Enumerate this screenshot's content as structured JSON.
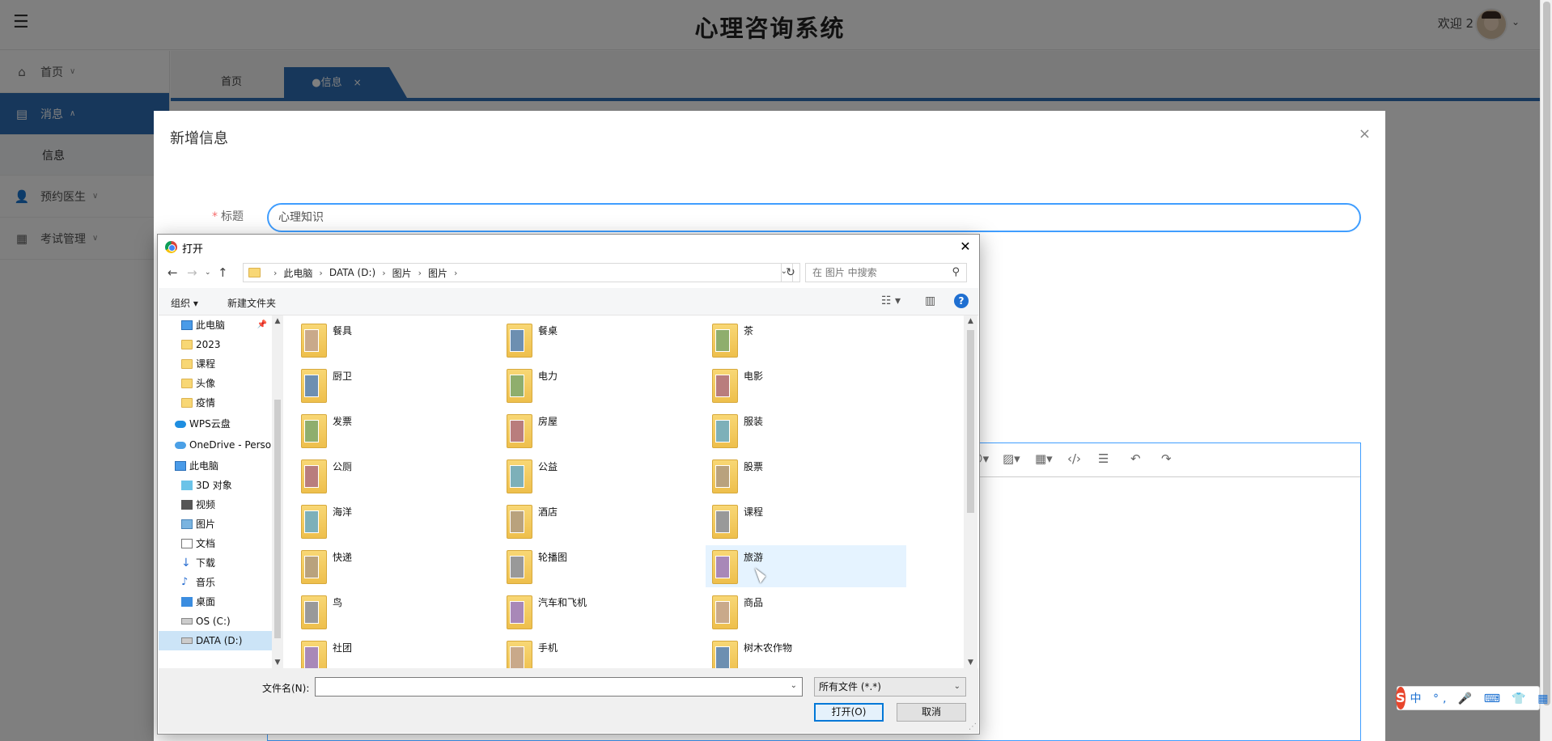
{
  "app": {
    "title": "心理咨询系统",
    "welcome": "欢迎 2"
  },
  "sidebar": {
    "items": [
      {
        "label": "首页",
        "icon": "home-icon"
      },
      {
        "label": "消息",
        "icon": "message-icon",
        "expanded": true,
        "children": [
          "信息"
        ]
      },
      {
        "label": "预约医生",
        "icon": "user-icon"
      },
      {
        "label": "考试管理",
        "icon": "grid-icon"
      }
    ],
    "sub_label": "信息"
  },
  "tabs": [
    {
      "label": "首页"
    },
    {
      "label": "●信息",
      "close": "×",
      "active": true
    }
  ],
  "modal": {
    "title": "新增信息",
    "close": "×",
    "field_label": "标题",
    "required_mark": "*",
    "title_value": "心理知识"
  },
  "file_dialog": {
    "title": "打开",
    "close": "✕",
    "breadcrumb": [
      "此电脑",
      "DATA (D:)",
      "图片",
      "图片"
    ],
    "search_placeholder": "在 图片 中搜索",
    "organize": "组织 ▾",
    "new_folder": "新建文件夹",
    "help": "?",
    "tree": [
      {
        "label": "此电脑",
        "icon": "pc",
        "indent": 1,
        "pin": true
      },
      {
        "label": "2023",
        "icon": "folder",
        "indent": 1
      },
      {
        "label": "课程",
        "icon": "folder",
        "indent": 1
      },
      {
        "label": "头像",
        "icon": "folder",
        "indent": 1
      },
      {
        "label": "疫情",
        "icon": "folder",
        "indent": 1
      },
      {
        "label": "",
        "icon": "",
        "indent": 0,
        "spacer": true
      },
      {
        "label": "WPS云盘",
        "icon": "cloud",
        "indent": 0
      },
      {
        "label": "",
        "icon": "",
        "indent": 0,
        "spacer": true
      },
      {
        "label": "OneDrive - Perso",
        "icon": "cloud-w",
        "indent": 0
      },
      {
        "label": "",
        "icon": "",
        "indent": 0,
        "spacer": true
      },
      {
        "label": "此电脑",
        "icon": "pc",
        "indent": 0
      },
      {
        "label": "3D 对象",
        "icon": "3d",
        "indent": 1
      },
      {
        "label": "视频",
        "icon": "video",
        "indent": 1
      },
      {
        "label": "图片",
        "icon": "pic",
        "indent": 1
      },
      {
        "label": "文档",
        "icon": "doc",
        "indent": 1
      },
      {
        "label": "下载",
        "icon": "down",
        "indent": 1
      },
      {
        "label": "音乐",
        "icon": "music",
        "indent": 1
      },
      {
        "label": "桌面",
        "icon": "desk",
        "indent": 1
      },
      {
        "label": "OS (C:)",
        "icon": "drive",
        "indent": 1
      },
      {
        "label": "DATA (D:)",
        "icon": "drive",
        "indent": 1,
        "selected": true
      }
    ],
    "files": [
      [
        "餐具",
        "餐桌",
        "茶"
      ],
      [
        "厨卫",
        "电力",
        "电影"
      ],
      [
        "发票",
        "房屋",
        "服装"
      ],
      [
        "公厕",
        "公益",
        "股票"
      ],
      [
        "海洋",
        "酒店",
        "课程"
      ],
      [
        "快递",
        "轮播图",
        "旅游"
      ],
      [
        "鸟",
        "汽车和飞机",
        "商品"
      ],
      [
        "社团",
        "手机",
        "树木农作物"
      ]
    ],
    "hover_file": "旅游",
    "filename_label": "文件名(N):",
    "filename_value": "",
    "filetype": "所有文件 (*.*)",
    "open_button": "打开(O)",
    "cancel_button": "取消"
  },
  "ime": {
    "logo": "S",
    "text": "中 °, 🎤 ⌨ 👕 ▦"
  },
  "colors": {
    "primary": "#2e6fb6",
    "input_focus": "#409eff",
    "dialog_accent": "#0078d7"
  }
}
